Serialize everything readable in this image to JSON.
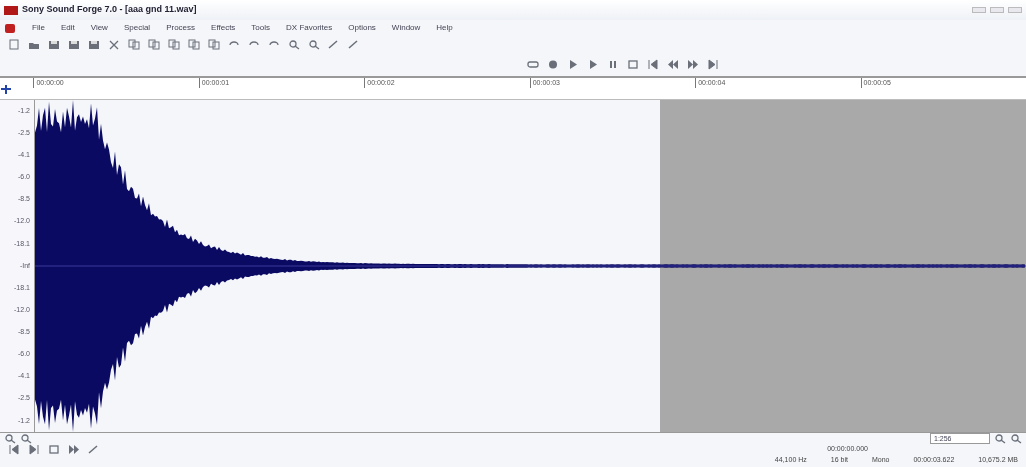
{
  "window": {
    "title": "Sony Sound Forge 7.0 - [aaa gnd 11.wav]"
  },
  "menu": [
    "File",
    "Edit",
    "View",
    "Special",
    "Process",
    "Effects",
    "Tools",
    "DX Favorites",
    "Options",
    "Window",
    "Help"
  ],
  "ruler": {
    "labels": [
      "00:00:00",
      "00:00:01",
      "00:00:02",
      "00:00:03",
      "00:00:04",
      "00:00:05"
    ]
  },
  "db_scale": [
    "-1.2",
    "-2.5",
    "-4.1",
    "-6.0",
    "-8.5",
    "-12.0",
    "-18.1",
    "-Inf",
    "-18.1",
    "-12.0",
    "-8.5",
    "-6.0",
    "-4.1",
    "-2.5",
    "-1.2"
  ],
  "zoom": {
    "value": "1:256"
  },
  "cursor_position": "00:00:00.000",
  "status_bar": [
    "44,100 Hz",
    "16 bit",
    "Mono",
    "00:00:03.622",
    "10,675.2 MB"
  ]
}
